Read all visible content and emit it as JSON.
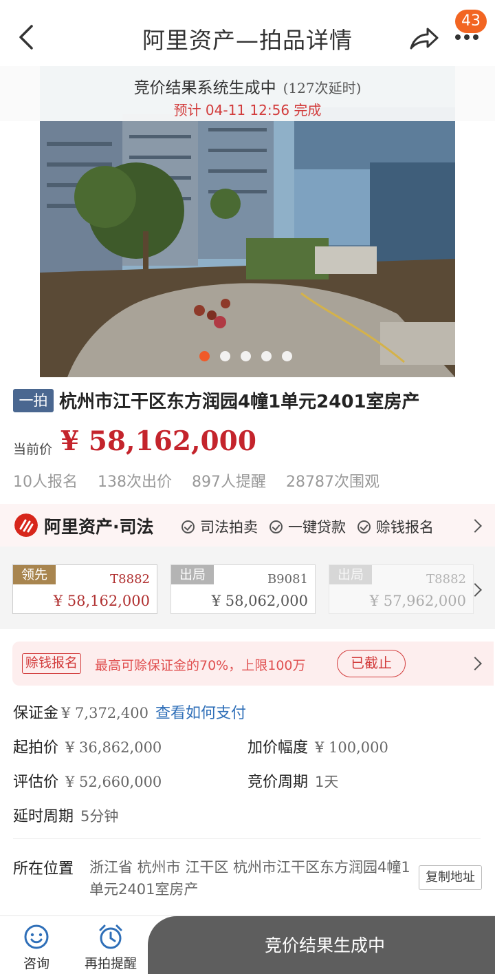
{
  "nav": {
    "title": "阿里资产—拍品详情",
    "badge_count": "43",
    "back_icon": "chevron-left-icon",
    "share_icon": "share-icon",
    "more_icon": "more-icon"
  },
  "gallery": {
    "status_line": "竞价结果系统生成中",
    "delay_count": "(127次延时)",
    "eta_line": "预计 04-11 12:56 完成",
    "image_count": 5,
    "active_index": 0
  },
  "item": {
    "tag": "一拍",
    "title": "杭州市江干区东方润园4幢1单元2401室房产",
    "price_label": "当前价",
    "price": "¥ 58,162,000",
    "stats": [
      "10人报名",
      "138次出价",
      "897人提醒",
      "28787次围观"
    ]
  },
  "brand": {
    "name": "阿里资产·司法",
    "features": [
      "司法拍卖",
      "一键贷款",
      "赊钱报名"
    ]
  },
  "bids": [
    {
      "status": "领先",
      "code": "T8882",
      "amount": "¥ 58,162,000"
    },
    {
      "status": "出局",
      "code": "B9081",
      "amount": "¥ 58,062,000"
    },
    {
      "status": "出局",
      "code": "T8882",
      "amount": "¥ 57,962,000"
    }
  ],
  "compensation": {
    "tag": "赊钱报名",
    "text": "最高可赊保证金的70%，上限100万",
    "button": "已截止"
  },
  "info": {
    "deposit_label": "保证金",
    "deposit_value": "¥ 7,372,400",
    "deposit_link": "查看如何支付",
    "start_label": "起拍价",
    "start_value": "¥ 36,862,000",
    "increment_label": "加价幅度",
    "increment_value": "¥ 100,000",
    "appraisal_label": "评估价",
    "appraisal_value": "¥ 52,660,000",
    "cycle_label": "竞价周期",
    "cycle_value": "1天",
    "delay_label": "延时周期",
    "delay_value": "5分钟",
    "location_label": "所在位置",
    "location_value": "浙江省 杭州市 江干区 杭州市江干区东方润园4幢1单元2401室房产",
    "copy_button": "复制地址"
  },
  "bottom": {
    "consult_label": "咨询",
    "remind_label": "再拍提醒",
    "main_button": "竞价结果生成中"
  },
  "colors": {
    "price_red": "#c4242c",
    "tag_blue": "#4a6790",
    "lead_gold": "#a8854f",
    "link_blue": "#2f6fb8",
    "badge_orange": "#f26522",
    "action_gray": "#5e5e5e"
  }
}
